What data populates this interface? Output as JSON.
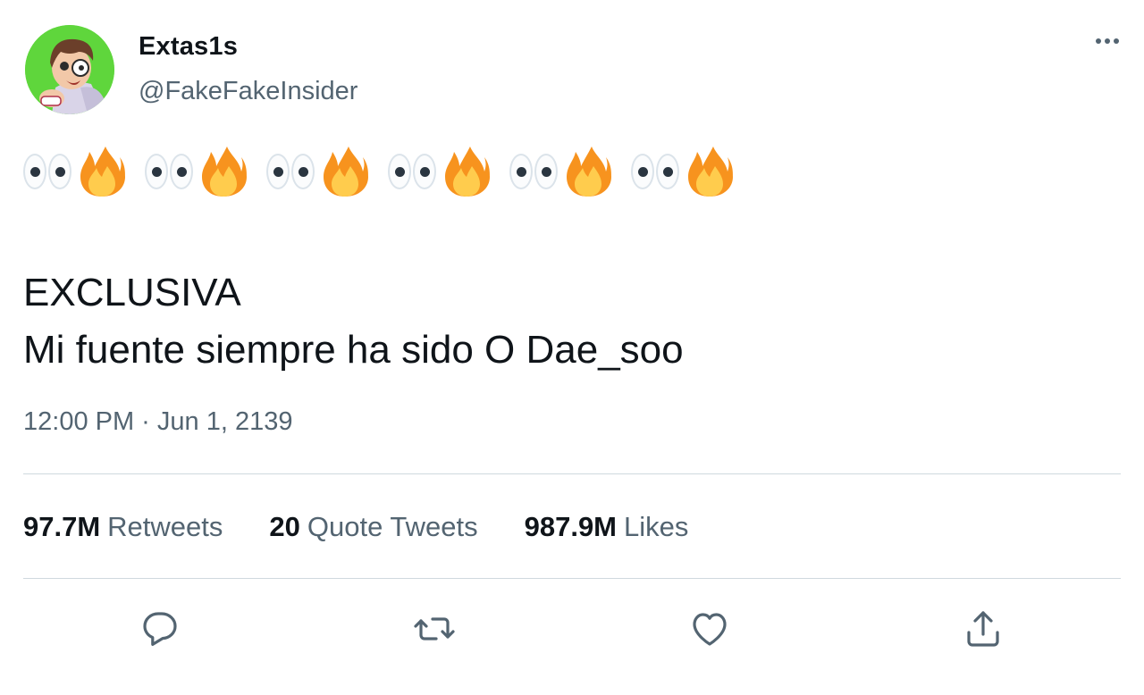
{
  "user": {
    "display_name": "Extas1s",
    "handle": "@FakeFakeInsider",
    "avatar_bg": "#5fd63c"
  },
  "tweet": {
    "emoji_line": [
      "eyes-icon",
      "fire-icon",
      "eyes-icon",
      "fire-icon",
      "eyes-icon",
      "fire-icon",
      "eyes-icon",
      "fire-icon",
      "eyes-icon",
      "fire-icon",
      "eyes-icon",
      "fire-icon"
    ],
    "line1": "EXCLUSIVA",
    "line2": "Mi fuente siempre ha sido O Dae_soo",
    "timestamp": "12:00 PM · Jun 1, 2139"
  },
  "stats": {
    "retweets_count": "97.7M",
    "retweets_label": "Retweets",
    "quotes_count": "20",
    "quotes_label": "Quote Tweets",
    "likes_count": "987.9M",
    "likes_label": "Likes"
  },
  "actions": [
    "reply-icon",
    "retweet-icon",
    "like-icon",
    "share-icon"
  ],
  "colors": {
    "text": "#0f1419",
    "secondary": "#536471",
    "divider": "#cfd9de"
  }
}
